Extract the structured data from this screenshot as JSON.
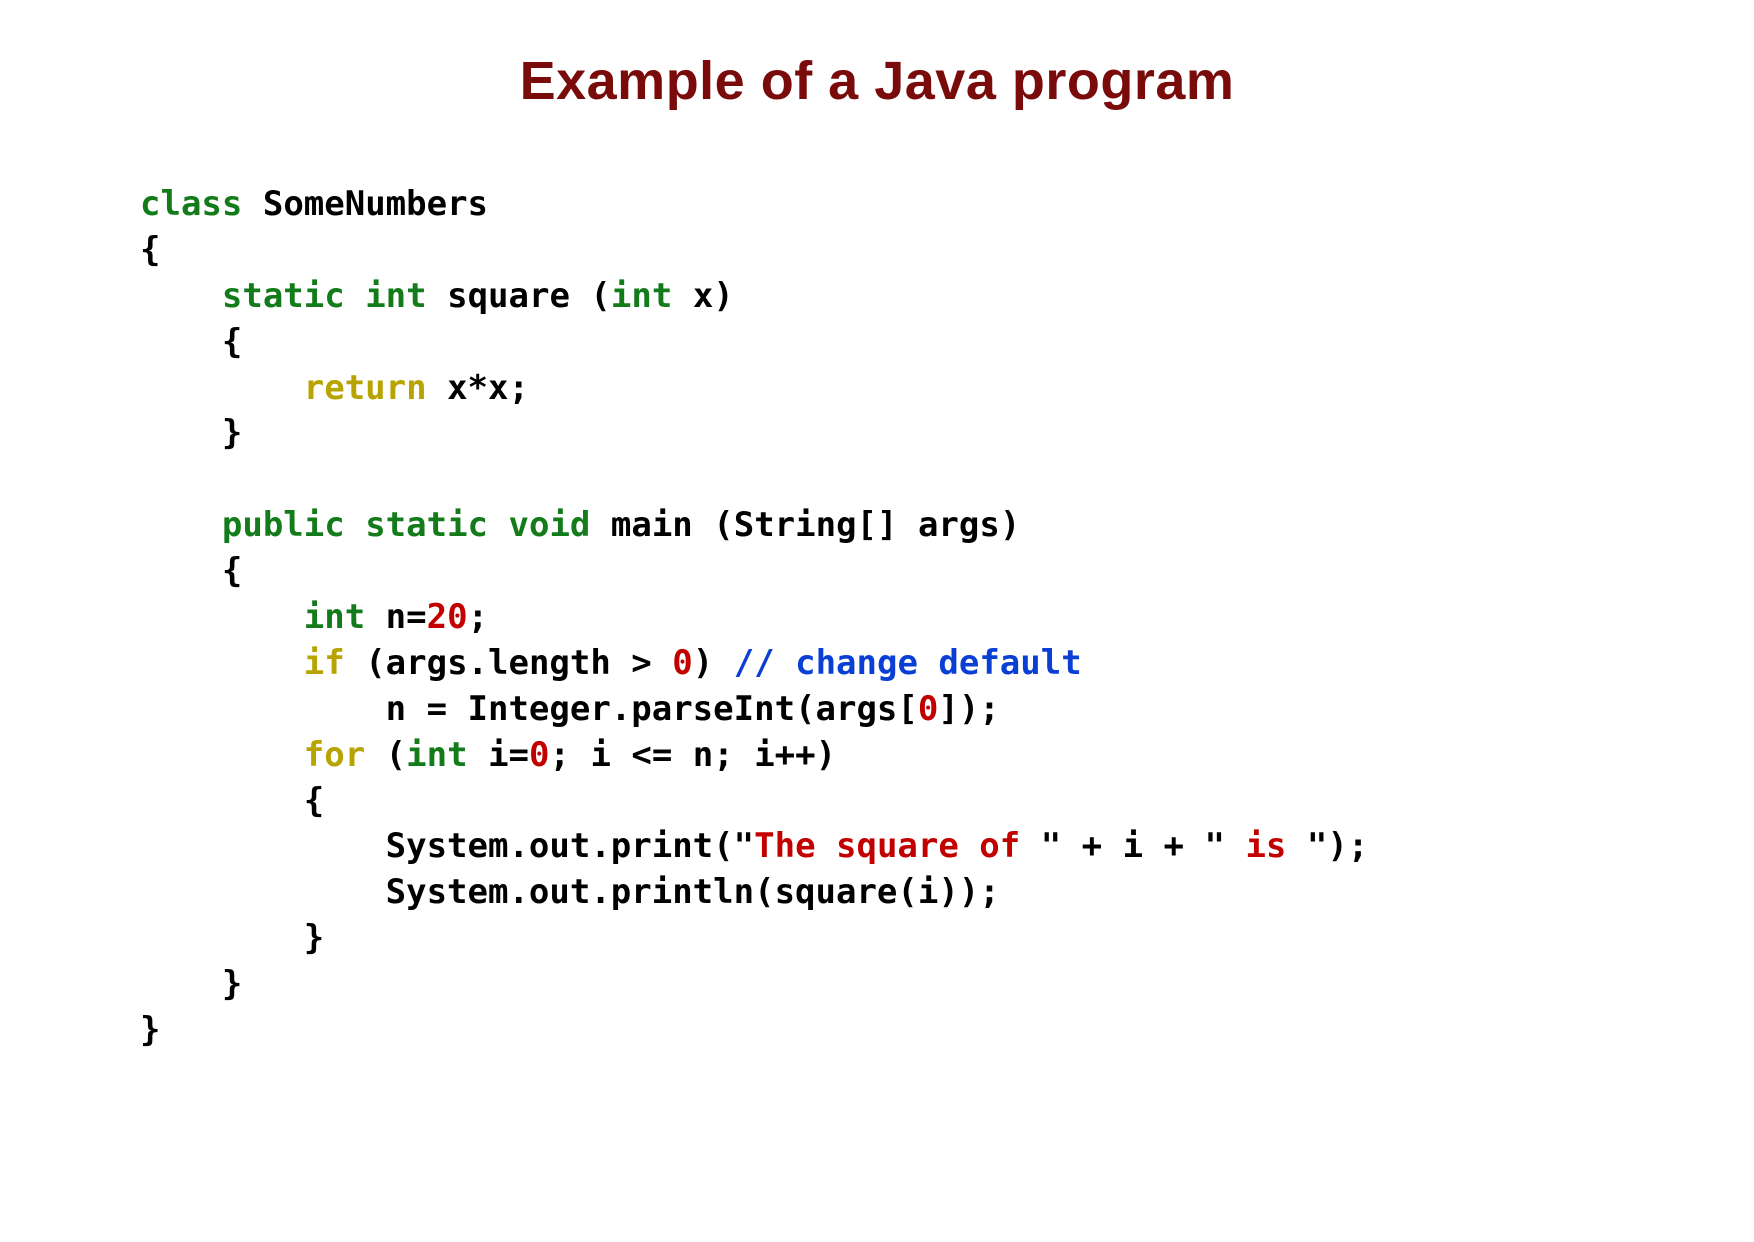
{
  "title": "Example of a Java program",
  "code": {
    "l1": {
      "class_c": "c",
      "class_rest": "lass",
      "sp": " ",
      "name": "SomeNumbers"
    },
    "l2": "{",
    "l3": {
      "ind": "    ",
      "static": "static",
      "sp1": " ",
      "int": "int",
      "sp2": " ",
      "name": "square",
      "sp3": " ",
      "op": "(",
      "intp": "int",
      "sp4": " ",
      "x": "x",
      "cp": ")"
    },
    "l4": "    {",
    "l5": {
      "ind": "        ",
      "ret": "return",
      "sp": " ",
      "expr": "x*x;"
    },
    "l6": "    }",
    "l7": "",
    "l8": {
      "ind": "    ",
      "public": "public",
      "sp1": " ",
      "static": "static",
      "sp2": " ",
      "void": "void",
      "sp3": " ",
      "main": "main",
      "sp4": " ",
      "args": "(String[] args)"
    },
    "l9": "    {",
    "l10": {
      "ind": "        ",
      "int": "int",
      "sp": " ",
      "n_eq": "n=",
      "twenty": "20",
      "semi": ";"
    },
    "l11": {
      "ind": "        ",
      "if": "if",
      "sp1": " ",
      "op": "(args.length > ",
      "zero": "0",
      "cp": ")",
      "sp2": " ",
      "comment": "// change default"
    },
    "l12": {
      "ind": "            ",
      "pre": "n = Integer.parseInt(args[",
      "zero": "0",
      "post": "]);"
    },
    "l13": {
      "ind": "        ",
      "for": "for",
      "sp": " ",
      "op": "(",
      "int": "int",
      "sp2": " ",
      "ieq": "i=",
      "zero": "0",
      "rest": "; i <= n; i++)"
    },
    "l14": "        {",
    "l15": {
      "ind": "            ",
      "pre": "System.out.print(",
      "q1": "\"",
      "str1": "The square of ",
      "q2": "\"",
      "mid": " + i + ",
      "q3": "\"",
      "str2": " is ",
      "q4": "\"",
      "post": ");"
    },
    "l16": {
      "ind": "            ",
      "txt": "System.out.println(square(i));"
    },
    "l17": "        }",
    "l18": "    }",
    "l19": "}"
  }
}
